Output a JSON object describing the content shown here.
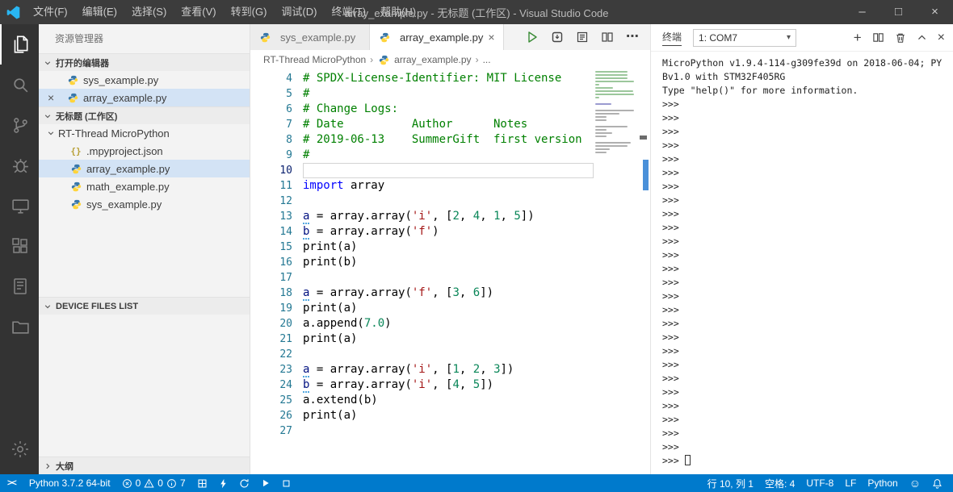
{
  "title_bar": {
    "menus": [
      "文件(F)",
      "编辑(E)",
      "选择(S)",
      "查看(V)",
      "转到(G)",
      "调试(D)",
      "终端(T)",
      "帮助(H)"
    ],
    "title": "array_example.py - 无标题 (工作区) - Visual Studio Code",
    "window_controls": {
      "minimize": "–",
      "maximize": "□",
      "close": "×"
    }
  },
  "activity_bar": {
    "items": [
      {
        "name": "explorer",
        "active": true
      },
      {
        "name": "search",
        "active": false
      },
      {
        "name": "source-control",
        "active": false
      },
      {
        "name": "debug",
        "active": false
      },
      {
        "name": "remote",
        "active": false
      },
      {
        "name": "extensions",
        "active": false
      },
      {
        "name": "notebook",
        "active": false
      },
      {
        "name": "documents",
        "active": false
      }
    ],
    "bottom": [
      {
        "name": "settings",
        "active": false
      }
    ]
  },
  "sidebar": {
    "title": "资源管理器",
    "open_editors": {
      "label": "打开的编辑器",
      "items": [
        {
          "label": "sys_example.py",
          "active": false
        },
        {
          "label": "array_example.py",
          "active": true
        }
      ]
    },
    "workspace": {
      "label": "无标题 (工作区)",
      "folder": "RT-Thread MicroPython",
      "files": [
        {
          "label": ".mpyproject.json",
          "icon": "json",
          "selected": false
        },
        {
          "label": "array_example.py",
          "icon": "python",
          "selected": true
        },
        {
          "label": "math_example.py",
          "icon": "python",
          "selected": false
        },
        {
          "label": "sys_example.py",
          "icon": "python",
          "selected": false
        }
      ]
    },
    "device_files_label": "DEVICE FILES LIST",
    "outline_label": "大纲"
  },
  "editor": {
    "tabs": [
      {
        "label": "sys_example.py",
        "active": false
      },
      {
        "label": "array_example.py",
        "active": true
      }
    ],
    "breadcrumbs": [
      "RT-Thread MicroPython",
      "array_example.py",
      "..."
    ],
    "minimap_extra_top_lines": 3,
    "code_lines": [
      {
        "num": "4",
        "tokens": [
          [
            "comment",
            "# SPDX-License-Identifier: MIT License"
          ]
        ]
      },
      {
        "num": "5",
        "tokens": [
          [
            "comment",
            "#"
          ]
        ]
      },
      {
        "num": "6",
        "tokens": [
          [
            "comment",
            "# Change Logs:"
          ]
        ]
      },
      {
        "num": "7",
        "tokens": [
          [
            "comment",
            "# Date          Author      Notes"
          ]
        ]
      },
      {
        "num": "8",
        "tokens": [
          [
            "comment",
            "# 2019-06-13    SummerGift  first version"
          ]
        ]
      },
      {
        "num": "9",
        "tokens": [
          [
            "comment",
            "#"
          ]
        ]
      },
      {
        "num": "10",
        "tokens": [],
        "current": true
      },
      {
        "num": "11",
        "tokens": [
          [
            "keyword",
            "import"
          ],
          [
            "plain",
            " array"
          ]
        ]
      },
      {
        "num": "12",
        "tokens": []
      },
      {
        "num": "13",
        "tokens": [
          [
            "var-diag",
            "a"
          ],
          [
            "plain",
            " = array.array("
          ],
          [
            "string",
            "'i'"
          ],
          [
            "plain",
            ", ["
          ],
          [
            "number",
            "2"
          ],
          [
            "plain",
            ", "
          ],
          [
            "number",
            "4"
          ],
          [
            "plain",
            ", "
          ],
          [
            "number",
            "1"
          ],
          [
            "plain",
            ", "
          ],
          [
            "number",
            "5"
          ],
          [
            "plain",
            "])"
          ]
        ]
      },
      {
        "num": "14",
        "tokens": [
          [
            "var-diag",
            "b"
          ],
          [
            "plain",
            " = array.array("
          ],
          [
            "string",
            "'f'"
          ],
          [
            "plain",
            ")"
          ]
        ]
      },
      {
        "num": "15",
        "tokens": [
          [
            "plain",
            "print(a)"
          ]
        ]
      },
      {
        "num": "16",
        "tokens": [
          [
            "plain",
            "print(b)"
          ]
        ]
      },
      {
        "num": "17",
        "tokens": []
      },
      {
        "num": "18",
        "tokens": [
          [
            "var-diag",
            "a"
          ],
          [
            "plain",
            " = array.array("
          ],
          [
            "string",
            "'f'"
          ],
          [
            "plain",
            ", ["
          ],
          [
            "number",
            "3"
          ],
          [
            "plain",
            ", "
          ],
          [
            "number",
            "6"
          ],
          [
            "plain",
            "])"
          ]
        ]
      },
      {
        "num": "19",
        "tokens": [
          [
            "plain",
            "print(a)"
          ]
        ]
      },
      {
        "num": "20",
        "tokens": [
          [
            "plain",
            "a.append("
          ],
          [
            "number",
            "7.0"
          ],
          [
            "plain",
            ")"
          ]
        ]
      },
      {
        "num": "21",
        "tokens": [
          [
            "plain",
            "print(a)"
          ]
        ]
      },
      {
        "num": "22",
        "tokens": []
      },
      {
        "num": "23",
        "tokens": [
          [
            "var-diag",
            "a"
          ],
          [
            "plain",
            " = array.array("
          ],
          [
            "string",
            "'i'"
          ],
          [
            "plain",
            ", ["
          ],
          [
            "number",
            "1"
          ],
          [
            "plain",
            ", "
          ],
          [
            "number",
            "2"
          ],
          [
            "plain",
            ", "
          ],
          [
            "number",
            "3"
          ],
          [
            "plain",
            "])"
          ]
        ]
      },
      {
        "num": "24",
        "tokens": [
          [
            "var-diag",
            "b"
          ],
          [
            "plain",
            " = array.array("
          ],
          [
            "string",
            "'i'"
          ],
          [
            "plain",
            ", ["
          ],
          [
            "number",
            "4"
          ],
          [
            "plain",
            ", "
          ],
          [
            "number",
            "5"
          ],
          [
            "plain",
            "])"
          ]
        ]
      },
      {
        "num": "25",
        "tokens": [
          [
            "plain",
            "a.extend(b)"
          ]
        ]
      },
      {
        "num": "26",
        "tokens": [
          [
            "plain",
            "print(a)"
          ]
        ]
      },
      {
        "num": "27",
        "tokens": []
      }
    ]
  },
  "terminal": {
    "title": "终端",
    "dropdown_value": "1: COM7",
    "intro_lines": [
      "MicroPython v1.9.4-114-g309fe39d on 2018-06-04; PY",
      "Bv1.0 with STM32F405RG",
      "Type \"help()\" for more information."
    ],
    "prompt": ">>>",
    "prompt_count": 26
  },
  "status_bar": {
    "remote_indicator": "><",
    "interpreter": "Python 3.7.2 64-bit",
    "problems": {
      "errors": "0",
      "warnings": "0",
      "infos": "7"
    },
    "line_col": "行 10, 列 1",
    "indentation": "空格: 4",
    "encoding": "UTF-8",
    "eol": "LF",
    "language": "Python"
  }
}
